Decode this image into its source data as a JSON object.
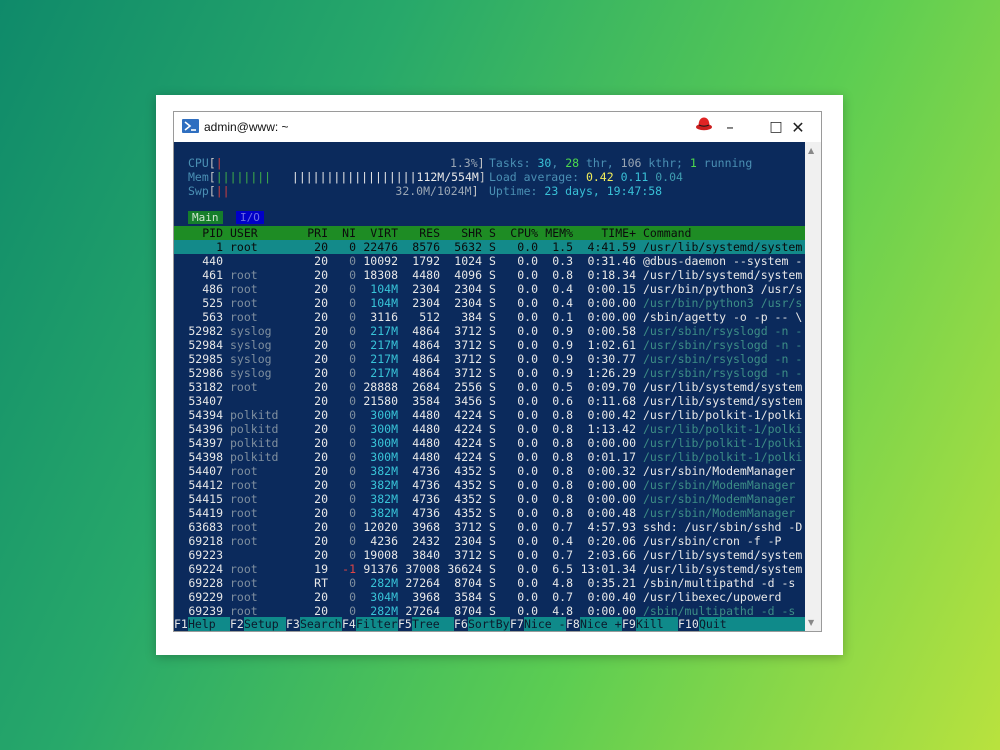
{
  "window": {
    "title": "admin@www: ~"
  },
  "icons": {
    "app": "powershell-terminal-icon",
    "redhat": "red-hat-icon",
    "minimize": "minimize-icon",
    "maximize": "maximize-icon",
    "close": "close-icon"
  },
  "meters": {
    "cpu": {
      "label": "CPU",
      "bar_green": "",
      "bar_red": "|",
      "value": "1.3%"
    },
    "mem": {
      "label": "Mem",
      "bar_green": "||||||||",
      "bar_white": "||||||||||||||||||",
      "value": "112M/554M"
    },
    "swp": {
      "label": "Swp",
      "bar_red": "||",
      "value": "32.0M/1024M"
    }
  },
  "stats": {
    "tasks_label": "Tasks:",
    "tasks": "30",
    "thr": "28",
    "thr_label": "thr,",
    "kthr": "106",
    "kthr_label": "kthr;",
    "running": "1",
    "running_label": "running",
    "load_label": "Load average:",
    "load1": "0.42",
    "load5": "0.11",
    "load15": "0.04",
    "uptime_label": "Uptime:",
    "uptime": "23 days, 19:47:58"
  },
  "tabs": [
    "Main",
    "I/O"
  ],
  "header": {
    "pid": "PID",
    "user": "USER",
    "pri": "PRI",
    "ni": "NI",
    "virt": "VIRT",
    "res": "RES",
    "shr": "SHR",
    "s": "S",
    "cpu": "CPU%",
    "mem": "MEM%",
    "time": "TIME+",
    "command": "Command"
  },
  "processes": [
    {
      "pid": "1",
      "user": "root",
      "pri": "20",
      "ni": "0",
      "virt": "22476",
      "res": "8576",
      "shr": "5632",
      "s": "S",
      "cpu": "0.0",
      "mem": "1.5",
      "time": "4:41.59",
      "cmd": "/usr/lib/systemd/system"
    },
    {
      "pid": "440",
      "user": "",
      "pri": "20",
      "ni": "0",
      "virt": "10092",
      "res": "1792",
      "shr": "1024",
      "s": "S",
      "cpu": "0.0",
      "mem": "0.3",
      "time": "0:31.46",
      "cmd": "@dbus-daemon --system -"
    },
    {
      "pid": "461",
      "user": "root",
      "pri": "20",
      "ni": "0",
      "virt": "18308",
      "res": "4480",
      "shr": "4096",
      "s": "S",
      "cpu": "0.0",
      "mem": "0.8",
      "time": "0:18.34",
      "cmd": "/usr/lib/systemd/system"
    },
    {
      "pid": "486",
      "user": "root",
      "pri": "20",
      "ni": "0",
      "virt": "104M",
      "res": "2304",
      "shr": "2304",
      "s": "S",
      "cpu": "0.0",
      "mem": "0.4",
      "time": "0:00.15",
      "cmd": "/usr/bin/python3 /usr/s"
    },
    {
      "pid": "525",
      "user": "root",
      "pri": "20",
      "ni": "0",
      "virt": "104M",
      "res": "2304",
      "shr": "2304",
      "s": "S",
      "cpu": "0.0",
      "mem": "0.4",
      "time": "0:00.00",
      "cmd": "/usr/bin/python3 /usr/s"
    },
    {
      "pid": "563",
      "user": "root",
      "pri": "20",
      "ni": "0",
      "virt": "3116",
      "res": "512",
      "shr": "384",
      "s": "S",
      "cpu": "0.0",
      "mem": "0.1",
      "time": "0:00.00",
      "cmd": "/sbin/agetty -o -p -- \\"
    },
    {
      "pid": "52982",
      "user": "syslog",
      "pri": "20",
      "ni": "0",
      "virt": "217M",
      "res": "4864",
      "shr": "3712",
      "s": "S",
      "cpu": "0.0",
      "mem": "0.9",
      "time": "0:00.58",
      "cmd": "/usr/sbin/rsyslogd -n -"
    },
    {
      "pid": "52984",
      "user": "syslog",
      "pri": "20",
      "ni": "0",
      "virt": "217M",
      "res": "4864",
      "shr": "3712",
      "s": "S",
      "cpu": "0.0",
      "mem": "0.9",
      "time": "1:02.61",
      "cmd": "/usr/sbin/rsyslogd -n -"
    },
    {
      "pid": "52985",
      "user": "syslog",
      "pri": "20",
      "ni": "0",
      "virt": "217M",
      "res": "4864",
      "shr": "3712",
      "s": "S",
      "cpu": "0.0",
      "mem": "0.9",
      "time": "0:30.77",
      "cmd": "/usr/sbin/rsyslogd -n -"
    },
    {
      "pid": "52986",
      "user": "syslog",
      "pri": "20",
      "ni": "0",
      "virt": "217M",
      "res": "4864",
      "shr": "3712",
      "s": "S",
      "cpu": "0.0",
      "mem": "0.9",
      "time": "1:26.29",
      "cmd": "/usr/sbin/rsyslogd -n -"
    },
    {
      "pid": "53182",
      "user": "root",
      "pri": "20",
      "ni": "0",
      "virt": "28888",
      "res": "2684",
      "shr": "2556",
      "s": "S",
      "cpu": "0.0",
      "mem": "0.5",
      "time": "0:09.70",
      "cmd": "/usr/lib/systemd/system"
    },
    {
      "pid": "53407",
      "user": "",
      "pri": "20",
      "ni": "0",
      "virt": "21580",
      "res": "3584",
      "shr": "3456",
      "s": "S",
      "cpu": "0.0",
      "mem": "0.6",
      "time": "0:11.68",
      "cmd": "/usr/lib/systemd/system"
    },
    {
      "pid": "54394",
      "user": "polkitd",
      "pri": "20",
      "ni": "0",
      "virt": "300M",
      "res": "4480",
      "shr": "4224",
      "s": "S",
      "cpu": "0.0",
      "mem": "0.8",
      "time": "0:00.42",
      "cmd": "/usr/lib/polkit-1/polki"
    },
    {
      "pid": "54396",
      "user": "polkitd",
      "pri": "20",
      "ni": "0",
      "virt": "300M",
      "res": "4480",
      "shr": "4224",
      "s": "S",
      "cpu": "0.0",
      "mem": "0.8",
      "time": "1:13.42",
      "cmd": "/usr/lib/polkit-1/polki"
    },
    {
      "pid": "54397",
      "user": "polkitd",
      "pri": "20",
      "ni": "0",
      "virt": "300M",
      "res": "4480",
      "shr": "4224",
      "s": "S",
      "cpu": "0.0",
      "mem": "0.8",
      "time": "0:00.00",
      "cmd": "/usr/lib/polkit-1/polki"
    },
    {
      "pid": "54398",
      "user": "polkitd",
      "pri": "20",
      "ni": "0",
      "virt": "300M",
      "res": "4480",
      "shr": "4224",
      "s": "S",
      "cpu": "0.0",
      "mem": "0.8",
      "time": "0:01.17",
      "cmd": "/usr/lib/polkit-1/polki"
    },
    {
      "pid": "54407",
      "user": "root",
      "pri": "20",
      "ni": "0",
      "virt": "382M",
      "res": "4736",
      "shr": "4352",
      "s": "S",
      "cpu": "0.0",
      "mem": "0.8",
      "time": "0:00.32",
      "cmd": "/usr/sbin/ModemManager"
    },
    {
      "pid": "54412",
      "user": "root",
      "pri": "20",
      "ni": "0",
      "virt": "382M",
      "res": "4736",
      "shr": "4352",
      "s": "S",
      "cpu": "0.0",
      "mem": "0.8",
      "time": "0:00.00",
      "cmd": "/usr/sbin/ModemManager"
    },
    {
      "pid": "54415",
      "user": "root",
      "pri": "20",
      "ni": "0",
      "virt": "382M",
      "res": "4736",
      "shr": "4352",
      "s": "S",
      "cpu": "0.0",
      "mem": "0.8",
      "time": "0:00.00",
      "cmd": "/usr/sbin/ModemManager"
    },
    {
      "pid": "54419",
      "user": "root",
      "pri": "20",
      "ni": "0",
      "virt": "382M",
      "res": "4736",
      "shr": "4352",
      "s": "S",
      "cpu": "0.0",
      "mem": "0.8",
      "time": "0:00.48",
      "cmd": "/usr/sbin/ModemManager"
    },
    {
      "pid": "63683",
      "user": "root",
      "pri": "20",
      "ni": "0",
      "virt": "12020",
      "res": "3968",
      "shr": "3712",
      "s": "S",
      "cpu": "0.0",
      "mem": "0.7",
      "time": "4:57.93",
      "cmd": "sshd: /usr/sbin/sshd -D"
    },
    {
      "pid": "69218",
      "user": "root",
      "pri": "20",
      "ni": "0",
      "virt": "4236",
      "res": "2432",
      "shr": "2304",
      "s": "S",
      "cpu": "0.0",
      "mem": "0.4",
      "time": "0:20.06",
      "cmd": "/usr/sbin/cron -f -P"
    },
    {
      "pid": "69223",
      "user": "",
      "pri": "20",
      "ni": "0",
      "virt": "19008",
      "res": "3840",
      "shr": "3712",
      "s": "S",
      "cpu": "0.0",
      "mem": "0.7",
      "time": "2:03.66",
      "cmd": "/usr/lib/systemd/system"
    },
    {
      "pid": "69224",
      "user": "root",
      "pri": "19",
      "ni": "-1",
      "virt": "91376",
      "res": "37008",
      "shr": "36624",
      "s": "S",
      "cpu": "0.0",
      "mem": "6.5",
      "time": "13:01.34",
      "cmd": "/usr/lib/systemd/system"
    },
    {
      "pid": "69228",
      "user": "root",
      "pri": "RT",
      "ni": "0",
      "virt": "282M",
      "res": "27264",
      "shr": "8704",
      "s": "S",
      "cpu": "0.0",
      "mem": "4.8",
      "time": "0:35.21",
      "cmd": "/sbin/multipathd -d -s"
    },
    {
      "pid": "69229",
      "user": "root",
      "pri": "20",
      "ni": "0",
      "virt": "304M",
      "res": "3968",
      "shr": "3584",
      "s": "S",
      "cpu": "0.0",
      "mem": "0.7",
      "time": "0:00.40",
      "cmd": "/usr/libexec/upowerd"
    },
    {
      "pid": "69239",
      "user": "root",
      "pri": "20",
      "ni": "0",
      "virt": "282M",
      "res": "27264",
      "shr": "8704",
      "s": "S",
      "cpu": "0.0",
      "mem": "4.8",
      "time": "0:00.00",
      "cmd": "/sbin/multipathd -d -s"
    }
  ],
  "fkeys": [
    {
      "key": "F1",
      "label": "Help"
    },
    {
      "key": "F2",
      "label": "Setup"
    },
    {
      "key": "F3",
      "label": "Search"
    },
    {
      "key": "F4",
      "label": "Filter"
    },
    {
      "key": "F5",
      "label": "Tree"
    },
    {
      "key": "F6",
      "label": "SortBy"
    },
    {
      "key": "F7",
      "label": "Nice -"
    },
    {
      "key": "F8",
      "label": "Nice +"
    },
    {
      "key": "F9",
      "label": "Kill"
    },
    {
      "key": "F10",
      "label": "Quit"
    }
  ]
}
